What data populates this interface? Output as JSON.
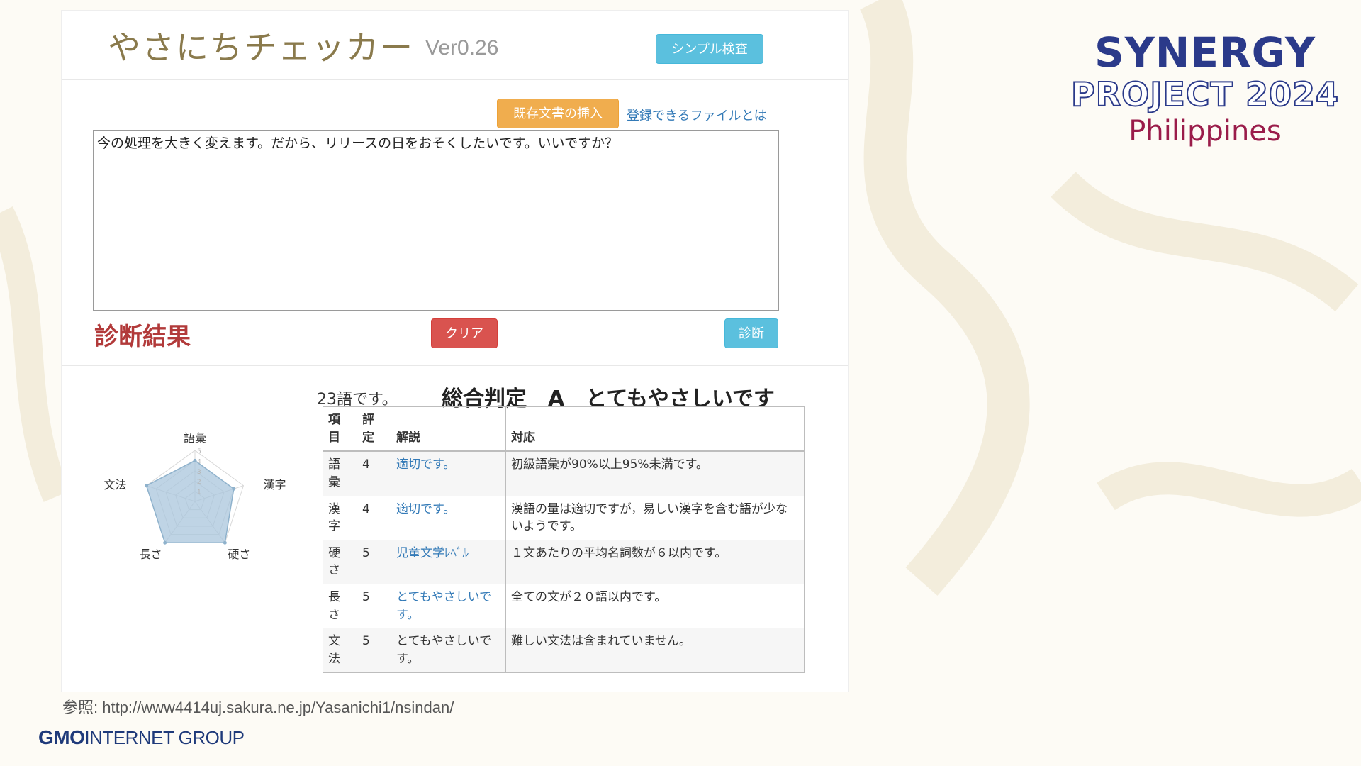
{
  "app": {
    "title": "やさにちチェッカー",
    "version": "Ver0.26",
    "simple_check_label": "シンプル検査"
  },
  "editor": {
    "insert_doc_label": "既存文書の挿入",
    "file_link": "登録できるファイルとは",
    "text": "今の処理を大きく変えます。だから、リリースの日をおそくしたいです。いいですか？"
  },
  "diagnosis": {
    "title": "診断結果",
    "clear_label": "クリア",
    "diagnose_label": "診断",
    "word_count": "23語です。",
    "overall": "総合判定　A　とてもやさしいです"
  },
  "radar": {
    "axes": [
      "語彙",
      "漢字",
      "硬さ",
      "長さ",
      "文法"
    ],
    "scale_ticks": [
      "1",
      "2",
      "3",
      "4",
      "5"
    ],
    "values": [
      4,
      4,
      5,
      5,
      5
    ],
    "max": 5,
    "fill_color": "#a9c6dc"
  },
  "table": {
    "headers": [
      "項目",
      "評定",
      "解説",
      "対応"
    ],
    "rows": [
      {
        "item": "語彙",
        "score": "4",
        "explanation": "適切です。",
        "explanation_link": true,
        "response": "初級語彙が90%以上95%未満です。"
      },
      {
        "item": "漢字",
        "score": "4",
        "explanation": "適切です。",
        "explanation_link": true,
        "response": "漢語の量は適切ですが，易しい漢字を含む語が少ないようです。"
      },
      {
        "item": "硬さ",
        "score": "5",
        "explanation": "児童文学ﾚﾍﾞﾙ",
        "explanation_link": true,
        "response": "１文あたりの平均名詞数が６以内です。"
      },
      {
        "item": "長さ",
        "score": "5",
        "explanation": "とてもやさしいです。",
        "explanation_link": true,
        "response": "全ての文が２０語以内です。"
      },
      {
        "item": "文法",
        "score": "5",
        "explanation": "とてもやさしいです。",
        "explanation_link": false,
        "response": "難しい文法は含まれていません。"
      }
    ]
  },
  "footer": {
    "reference": "参照: http://www4414uj.sakura.ne.jp/Yasanichi1/nsindan/",
    "gmo_bold": "GMO",
    "gmo_rest": "INTERNET GROUP"
  },
  "brand": {
    "line1": "SYNERGY",
    "line2": "PROJECT 2024",
    "line3": "Philippines"
  }
}
